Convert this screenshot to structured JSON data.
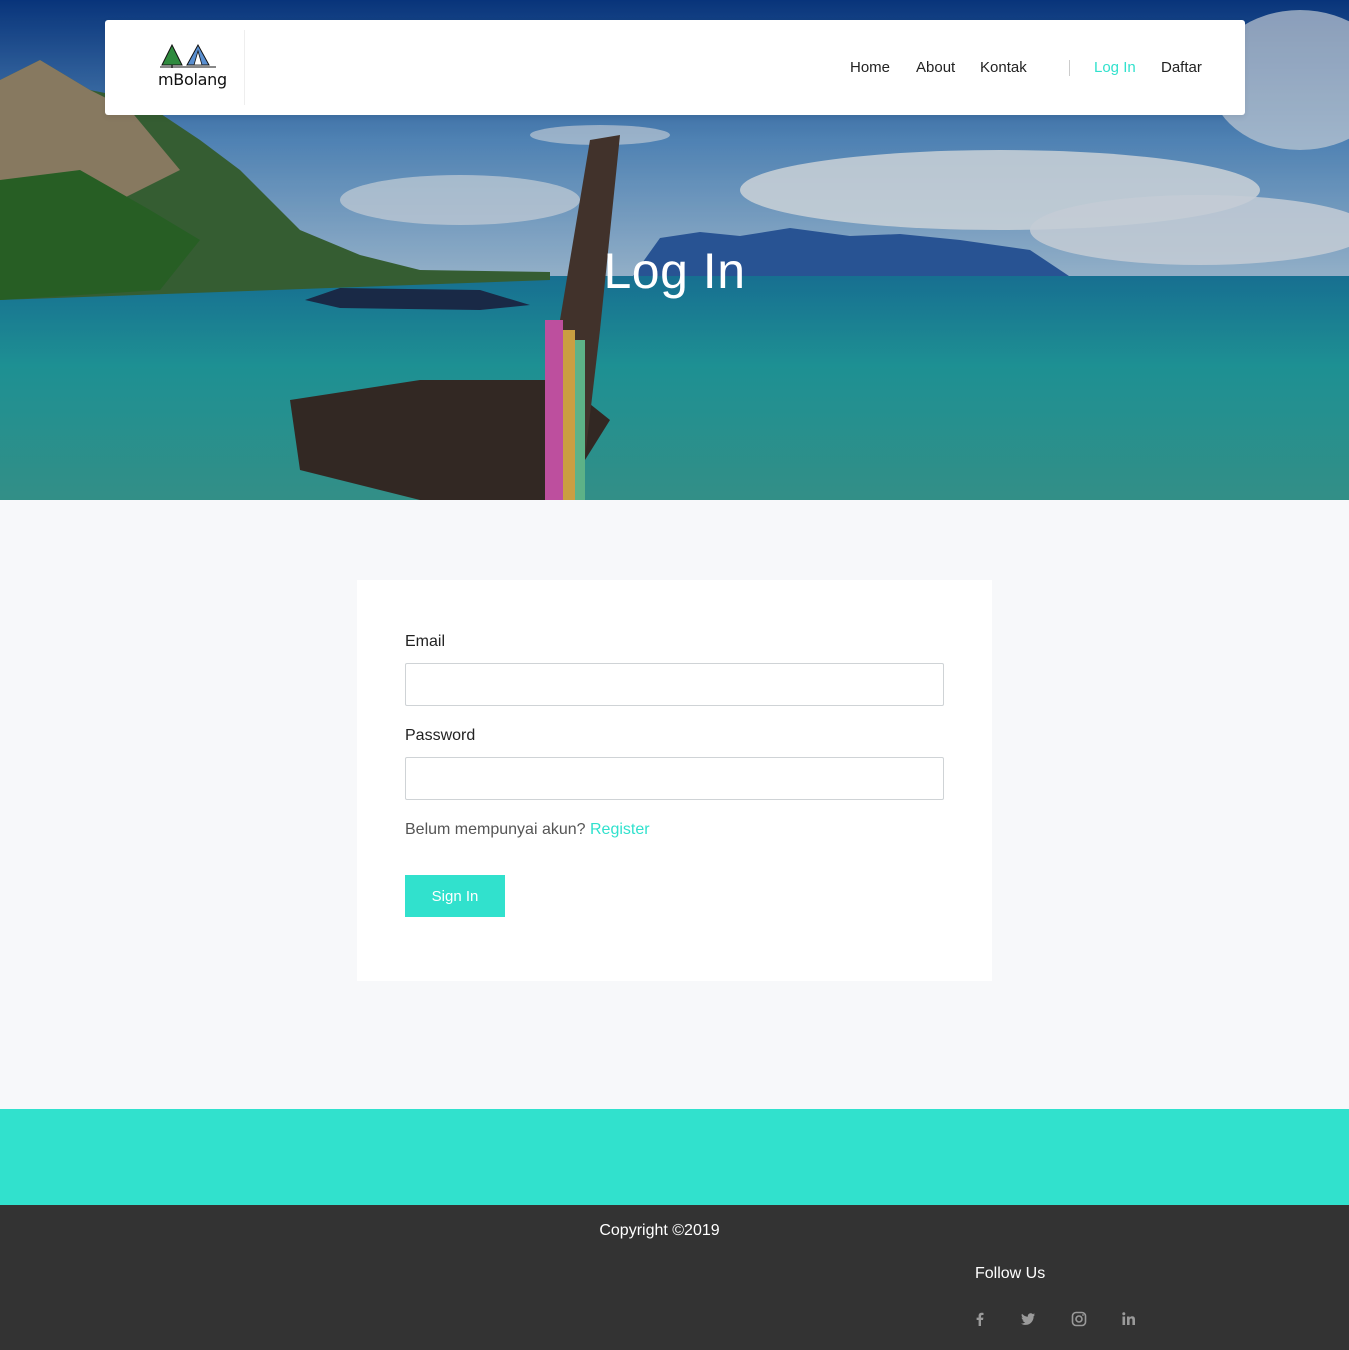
{
  "brand": {
    "logo_text": "mBolang"
  },
  "nav": {
    "home": "Home",
    "about": "About",
    "kontak": "Kontak",
    "login": "Log In",
    "daftar": "Daftar"
  },
  "hero": {
    "title": "Log In"
  },
  "form": {
    "email_label": "Email",
    "email_value": "",
    "password_label": "Password",
    "password_value": "",
    "no_account_text": "Belum mempunyai akun?",
    "register_link": "Register",
    "submit_label": "Sign In"
  },
  "footer": {
    "copyright": "Copyright ©2019",
    "follow_title": "Follow Us",
    "social_icons": [
      "facebook-icon",
      "twitter-icon",
      "instagram-icon",
      "linkedin-icon"
    ]
  },
  "colors": {
    "accent": "#31e1cd",
    "footer_bg": "#333333",
    "page_bg": "#f7f8fa"
  }
}
